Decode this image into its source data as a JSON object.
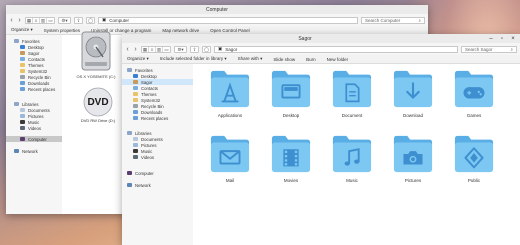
{
  "back_window": {
    "title": "Computer",
    "breadcrumb": "Computer",
    "search_placeholder": "Search Computer",
    "commands": [
      "Organize ▾",
      "System properties",
      "Uninstall or change a program",
      "Map network drive",
      "Open Control Panel"
    ],
    "sidebar": {
      "favorites_label": "Favorites",
      "favorites": [
        "Desktop",
        "Sagor",
        "Contacts",
        "Themes",
        "System32",
        "Recycle Bin",
        "Downloads",
        "Recent places"
      ],
      "libraries_label": "Libraries",
      "libraries": [
        "Documents",
        "Pictures",
        "Music",
        "Videos"
      ],
      "computer_label": "Computer",
      "network_label": "Network"
    },
    "drives": [
      "OS X YOSEMITE (C:)",
      "DVD RW Drive (D:)"
    ]
  },
  "front_window": {
    "title": "Sagor",
    "breadcrumb": "Sagor",
    "search_placeholder": "Search Sagor",
    "commands": [
      "Organize ▾",
      "Include selected folder in library ▾",
      "Share with ▾",
      "Slide show",
      "Burn",
      "New folder"
    ],
    "sidebar": {
      "favorites_label": "Favorites",
      "favorites": [
        "Desktop",
        "Sagor",
        "Contacts",
        "Themes",
        "System32",
        "Recycle Bin",
        "Downloads",
        "Recent places"
      ],
      "selected_favorite": "Sagor",
      "libraries_label": "Libraries",
      "libraries": [
        "Documents",
        "Pictures",
        "Music",
        "Videos"
      ],
      "computer_label": "Computer",
      "network_label": "Network"
    },
    "folders": [
      {
        "label": "Applications",
        "icon": "applications-icon"
      },
      {
        "label": "Desktop",
        "icon": "desktop-icon"
      },
      {
        "label": "Document",
        "icon": "document-icon"
      },
      {
        "label": "Download",
        "icon": "download-icon"
      },
      {
        "label": "Games",
        "icon": "gamepad-icon"
      },
      {
        "label": "Mail",
        "icon": "mail-icon"
      },
      {
        "label": "Movies",
        "icon": "film-icon"
      },
      {
        "label": "Music",
        "icon": "music-note-icon"
      },
      {
        "label": "Pictures",
        "icon": "camera-icon"
      },
      {
        "label": "Public",
        "icon": "public-icon"
      }
    ]
  },
  "colors": {
    "folder_body": "#7cc8f2",
    "folder_tab": "#5aaee6",
    "folder_glyph": "#3e8fd0",
    "sidebar_selection": "#cfe6fb"
  }
}
